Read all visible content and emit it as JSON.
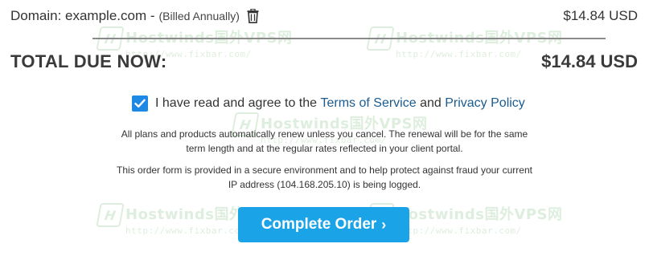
{
  "order": {
    "domain_label": "Domain: example.com - ",
    "billing": "(Billed Annually)",
    "domain_price": "$14.84 USD",
    "total_label": "TOTAL DUE NOW:",
    "total_amount": "$14.84 USD"
  },
  "agreement": {
    "checked": true,
    "text_before": "I have read and agree to the ",
    "terms_link": "Terms of Service",
    "and_text": " and ",
    "privacy_link": "Privacy Policy"
  },
  "notices": {
    "renewal_line1": "All plans and products automatically renew unless you cancel. The renewal will be for the same",
    "renewal_line2": "term length and at the regular rates reflected in your client portal.",
    "security_line1": "This order form is provided in a secure environment and to help protect against fraud your current",
    "security_line2": "IP address (104.168.205.10) is being logged."
  },
  "button": {
    "label": "Complete Order",
    "chevron": "›"
  },
  "watermark": {
    "brand": "Hostwinds国外VPS网",
    "url": "http://www.fixbar.com/",
    "logo": "H"
  },
  "colors": {
    "link": "#1a5c8f",
    "button": "#1ba3e8",
    "checkbox": "#1e88e5",
    "watermark": "#6bb36b"
  },
  "icons": {
    "delete": "trash-icon",
    "checkbox": "checkmark-icon"
  }
}
